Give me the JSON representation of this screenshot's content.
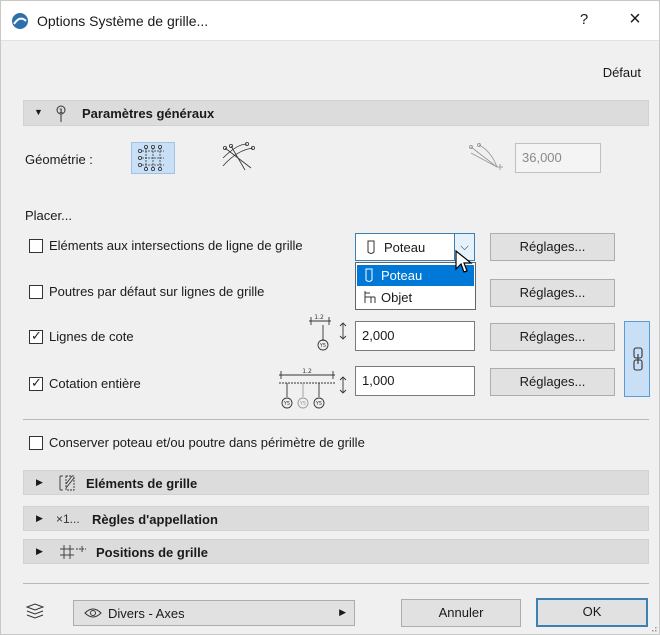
{
  "window": {
    "title": "Options Système de grille...",
    "help": "?",
    "close": "×"
  },
  "default_label": "Défaut",
  "general": {
    "header": "Paramètres généraux",
    "geometry_label": "Géométrie :",
    "angle_value": "36,000"
  },
  "place": {
    "heading": "Placer...",
    "intersections": {
      "label": "Eléments aux intersections de ligne de grille",
      "checked": false,
      "selected": "Poteau",
      "options": [
        "Poteau",
        "Objet"
      ],
      "settings_label": "Réglages..."
    },
    "beams": {
      "label": "Poutres par défaut sur lignes de grille",
      "checked": false,
      "settings_label": "Réglages..."
    },
    "dimension_lines": {
      "label": "Lignes de cote",
      "checked": true,
      "value": "2,000",
      "settings_label": "Réglages...",
      "icon_text": "1.2",
      "bubble": "Y5"
    },
    "full_dimension": {
      "label": "Cotation entière",
      "checked": true,
      "value": "1,000",
      "settings_label": "Réglages...",
      "icon_text": "1.2",
      "bubble": "Y5"
    }
  },
  "keep_perimeter": {
    "label": "Conserver poteau et/ou poutre dans périmètre de grille",
    "checked": false
  },
  "sections": [
    {
      "label": "Eléments de grille",
      "icon": "grid-elements-icon",
      "prefix": ""
    },
    {
      "label": "Règles d'appellation",
      "icon": "naming-icon",
      "prefix": "×1..."
    },
    {
      "label": "Positions de grille",
      "icon": "grid-positions-icon",
      "prefix": ""
    }
  ],
  "footer": {
    "layer": "Divers - Axes",
    "cancel": "Annuler",
    "ok": "OK"
  },
  "colors": {
    "accent": "#0078d7",
    "active_bg": "#c8dff5",
    "section_bg": "#dcdcdc"
  }
}
